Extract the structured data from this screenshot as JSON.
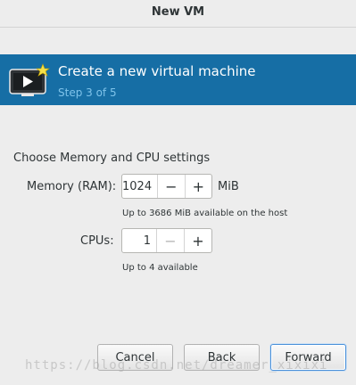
{
  "window": {
    "title": "New VM"
  },
  "banner": {
    "icon": "vm-monitor-icon",
    "title": "Create a new virtual machine",
    "step": "Step 3 of 5",
    "bg_color": "#166ea5"
  },
  "section": {
    "label": "Choose Memory and CPU settings"
  },
  "memory": {
    "label": "Memory (RAM):",
    "value": "1024",
    "minus": "−",
    "plus": "+",
    "unit": "MiB",
    "hint": "Up to 3686 MiB available on the host"
  },
  "cpus": {
    "label": "CPUs:",
    "value": "1",
    "minus": "−",
    "plus": "+",
    "hint": "Up to 4 available"
  },
  "buttons": {
    "cancel": "Cancel",
    "back": "Back",
    "forward": "Forward"
  },
  "watermark": "https://blog.csdn.net/dreamer_xixixi"
}
